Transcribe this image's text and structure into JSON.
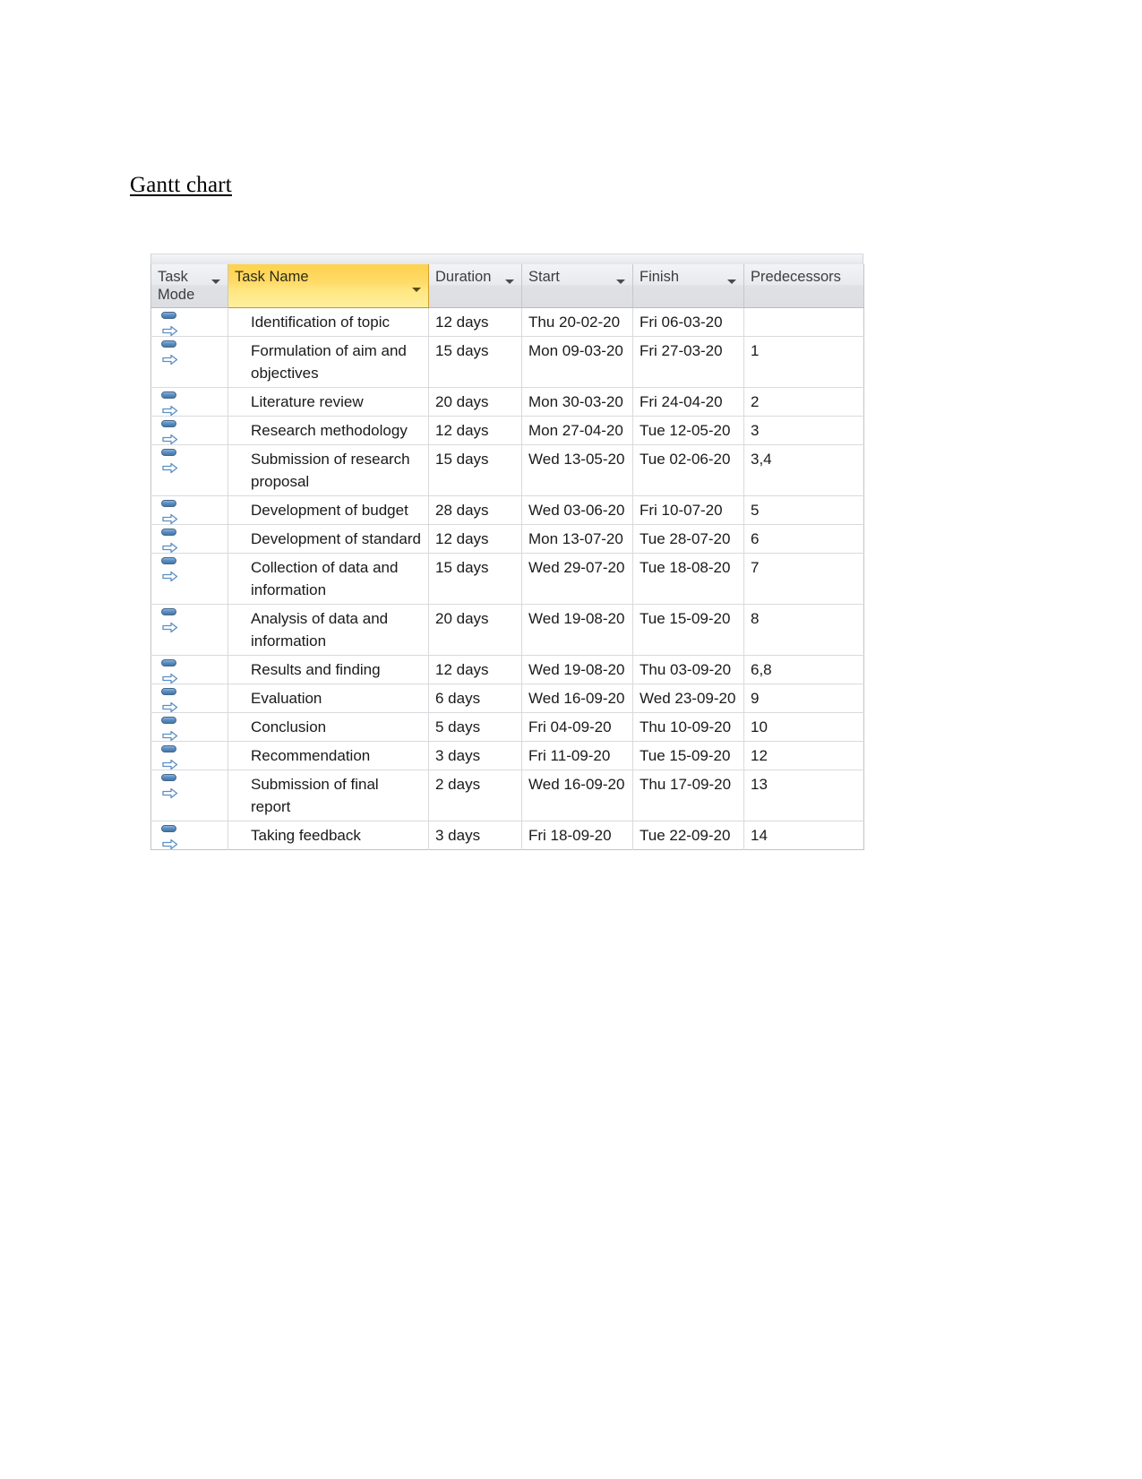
{
  "document": {
    "title": "Gantt chart"
  },
  "grid": {
    "columns": [
      {
        "key": "mode",
        "label": "Task Mode",
        "has_filter": true,
        "selected": false
      },
      {
        "key": "name",
        "label": "Task Name",
        "has_filter": true,
        "selected": true
      },
      {
        "key": "duration",
        "label": "Duration",
        "has_filter": true,
        "selected": false
      },
      {
        "key": "start",
        "label": "Start",
        "has_filter": true,
        "selected": false
      },
      {
        "key": "finish",
        "label": "Finish",
        "has_filter": true,
        "selected": false
      },
      {
        "key": "pred",
        "label": "Predecessors",
        "has_filter": false,
        "selected": false
      }
    ],
    "mode_icon": "auto-scheduled-icon",
    "accent_selected_header": "#ffd24d",
    "header_background": "#e9eaee",
    "rows": [
      {
        "mode": "auto-scheduled-icon",
        "name": "Identification of topic",
        "duration": "12 days",
        "start": "Thu 20-02-20",
        "finish": "Fri 06-03-20",
        "pred": ""
      },
      {
        "mode": "auto-scheduled-icon",
        "name": "Formulation of aim and objectives",
        "duration": "15 days",
        "start": "Mon 09-03-20",
        "finish": "Fri 27-03-20",
        "pred": "1"
      },
      {
        "mode": "auto-scheduled-icon",
        "name": "Literature review",
        "duration": "20 days",
        "start": "Mon 30-03-20",
        "finish": "Fri 24-04-20",
        "pred": "2"
      },
      {
        "mode": "auto-scheduled-icon",
        "name": "Research methodology",
        "duration": "12 days",
        "start": "Mon 27-04-20",
        "finish": "Tue 12-05-20",
        "pred": "3"
      },
      {
        "mode": "auto-scheduled-icon",
        "name": "Submission of research proposal",
        "duration": "15 days",
        "start": "Wed 13-05-20",
        "finish": "Tue 02-06-20",
        "pred": "3,4"
      },
      {
        "mode": "auto-scheduled-icon",
        "name": "Development of budget",
        "duration": "28 days",
        "start": "Wed 03-06-20",
        "finish": "Fri 10-07-20",
        "pred": "5"
      },
      {
        "mode": "auto-scheduled-icon",
        "name": "Development of standard",
        "duration": "12 days",
        "start": "Mon 13-07-20",
        "finish": "Tue 28-07-20",
        "pred": "6"
      },
      {
        "mode": "auto-scheduled-icon",
        "name": "Collection of data and information",
        "duration": "15 days",
        "start": "Wed 29-07-20",
        "finish": "Tue 18-08-20",
        "pred": "7"
      },
      {
        "mode": "auto-scheduled-icon",
        "name": "Analysis of data and information",
        "duration": "20 days",
        "start": "Wed 19-08-20",
        "finish": "Tue 15-09-20",
        "pred": "8"
      },
      {
        "mode": "auto-scheduled-icon",
        "name": "Results and finding",
        "duration": "12 days",
        "start": "Wed 19-08-20",
        "finish": "Thu 03-09-20",
        "pred": "6,8"
      },
      {
        "mode": "auto-scheduled-icon",
        "name": "Evaluation",
        "duration": "6 days",
        "start": "Wed 16-09-20",
        "finish": "Wed 23-09-20",
        "pred": "9"
      },
      {
        "mode": "auto-scheduled-icon",
        "name": "Conclusion",
        "duration": "5 days",
        "start": "Fri 04-09-20",
        "finish": "Thu 10-09-20",
        "pred": "10"
      },
      {
        "mode": "auto-scheduled-icon",
        "name": "Recommendation",
        "duration": "3 days",
        "start": "Fri 11-09-20",
        "finish": "Tue 15-09-20",
        "pred": "12"
      },
      {
        "mode": "auto-scheduled-icon",
        "name": "Submission of final report",
        "duration": "2 days",
        "start": "Wed 16-09-20",
        "finish": "Thu 17-09-20",
        "pred": "13"
      },
      {
        "mode": "auto-scheduled-icon",
        "name": "Taking feedback",
        "duration": "3 days",
        "start": "Fri 18-09-20",
        "finish": "Tue 22-09-20",
        "pred": "14"
      }
    ]
  }
}
